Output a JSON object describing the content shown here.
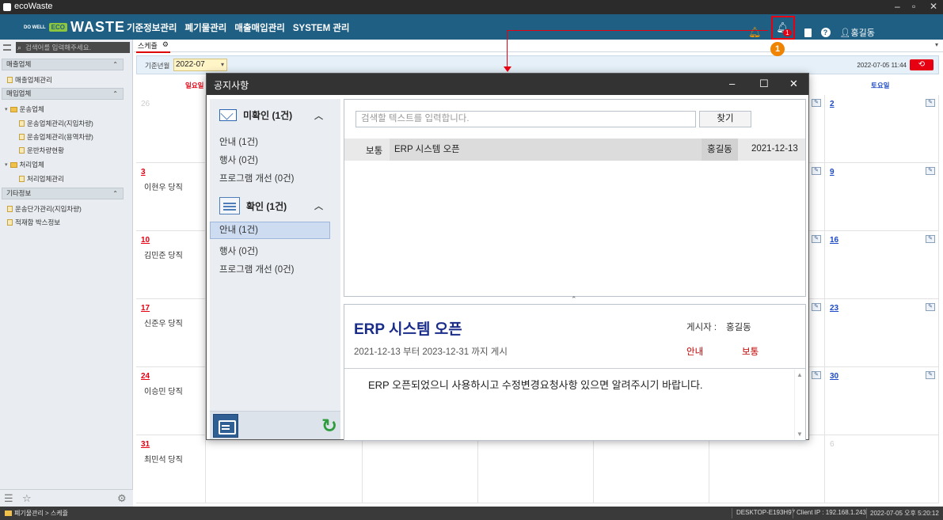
{
  "window": {
    "title": "ecoWaste",
    "min": "–",
    "restore": "▫",
    "close": "✕"
  },
  "logo": {
    "small": "DO WELL",
    "badge": "ECO",
    "text": "WASTE"
  },
  "menu": [
    "기준정보관리",
    "폐기물관리",
    "매출매입관리",
    "SYSTEM 관리"
  ],
  "topbar": {
    "notification_count": "1",
    "user": "홍길동",
    "help": "?",
    "callout": "1"
  },
  "sidebar": {
    "search_placeholder": "검색어를 입력해주세요.",
    "sections": [
      {
        "title": "매출업체",
        "items": [
          "매출업체관리"
        ]
      },
      {
        "title": "매입업체",
        "items": [
          "운송업체",
          "운송업체관리(지입차량)",
          "운송업체관리(용역차량)",
          "운반차량현황",
          "처리업체",
          "처리업체관리"
        ]
      },
      {
        "title": "기타정보",
        "items": [
          "운송단가관리(지입차량)",
          "적재함 박스정보"
        ]
      }
    ]
  },
  "tab": {
    "label": "스케쥴",
    "close": "⚙"
  },
  "filter": {
    "label": "기준년월",
    "value": "2022-07",
    "datetime": "2022-07-05 11:44"
  },
  "calendar": {
    "sunday": "일요일",
    "saturday": "토요일",
    "weeks": [
      {
        "sun": "26",
        "duty": "",
        "sat": "2"
      },
      {
        "sun": "3",
        "duty": "이현우 당직",
        "sat": "9"
      },
      {
        "sun": "10",
        "duty": "김민준 당직",
        "sat": "16"
      },
      {
        "sun": "17",
        "duty": "신준우 당직",
        "sat": "23"
      },
      {
        "sun": "24",
        "duty": "이승민 당직",
        "sat": "30"
      },
      {
        "sun": "31",
        "duty": "최민석 당직",
        "sat": "6"
      }
    ]
  },
  "status": {
    "path": "폐기물관리 > 스케쥴",
    "host": "DESKTOP-E193H97",
    "ip": "Client IP : 192.168.1.243",
    "datetime": "2022-07-05 오후 5:20:12"
  },
  "dialog": {
    "title": "공지사항",
    "unread": {
      "title": "미확인 (1건)",
      "cats": [
        "안내 (1건)",
        "행사 (0건)",
        "프로그램 개선 (0건)"
      ]
    },
    "read": {
      "title": "확인 (1건)",
      "cats": [
        "안내 (1건)",
        "행사 (0건)",
        "프로그램 개선 (0건)"
      ]
    },
    "search_placeholder": "검색할 텍스트를 입력합니다.",
    "find": "찾기",
    "row": {
      "priority": "보통",
      "title": "ERP 시스템 오픈",
      "author": "홍길동",
      "date": "2021-12-13"
    },
    "detail": {
      "title": "ERP 시스템 오픈",
      "poster_label": "게시자 :",
      "poster": "홍길동",
      "period": "2021-12-13 부터 2023-12-31 까지 게시",
      "category": "안내",
      "priority": "보통",
      "body": "ERP 오픈되었으니 사용하시고 수정변경요청사항 있으면 알려주시기 바랍니다."
    }
  }
}
